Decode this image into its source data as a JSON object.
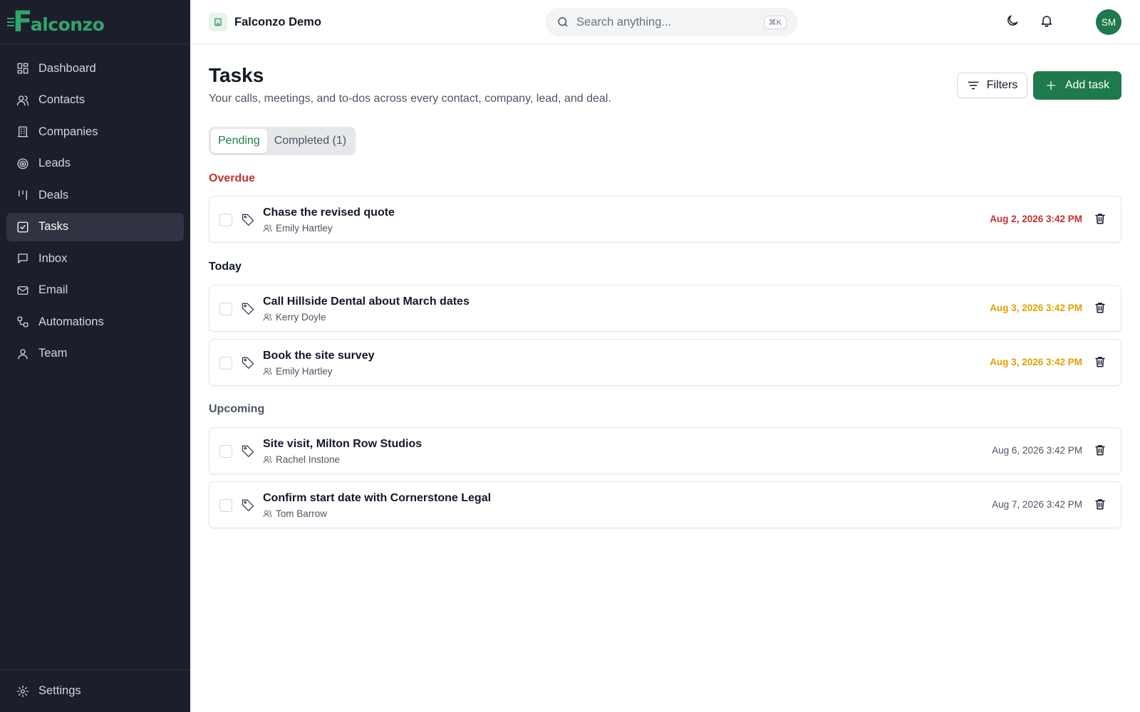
{
  "colors": {
    "sidebar_bg": "#1c1f2b",
    "brand": "#1e7a4c",
    "overdue": "#c53030",
    "today": "#e0a100",
    "upcoming": "#4b5563"
  },
  "brand": {
    "name": "alconzo",
    "mark": "F"
  },
  "sidebar": {
    "items": [
      {
        "label": "Dashboard",
        "icon": "dashboard-icon"
      },
      {
        "label": "Contacts",
        "icon": "users-icon"
      },
      {
        "label": "Companies",
        "icon": "building-icon"
      },
      {
        "label": "Leads",
        "icon": "target-icon"
      },
      {
        "label": "Deals",
        "icon": "kanban-icon"
      },
      {
        "label": "Tasks",
        "icon": "checkbox-icon",
        "active": true
      },
      {
        "label": "Inbox",
        "icon": "message-icon"
      },
      {
        "label": "Email",
        "icon": "mail-icon"
      },
      {
        "label": "Automations",
        "icon": "workflow-icon"
      },
      {
        "label": "Team",
        "icon": "user-icon"
      }
    ],
    "settings_label": "Settings"
  },
  "topbar": {
    "workspace": "Falconzo Demo",
    "search_placeholder": "Search anything...",
    "search_shortcut": "⌘K",
    "avatar_initials": "SM"
  },
  "page": {
    "title": "Tasks",
    "subtitle": "Your calls, meetings, and to-dos across every contact, company, lead, and deal.",
    "filters_label": "Filters",
    "add_label": "Add task",
    "tabs": [
      {
        "label": "Pending",
        "active": true
      },
      {
        "label": "Completed (1)",
        "active": false
      }
    ]
  },
  "sections": [
    {
      "heading": "Overdue",
      "tasks": [
        {
          "title": "Chase the revised quote",
          "person": "Emily Hartley",
          "due": "Aug 2, 2026 3:42 PM"
        }
      ]
    },
    {
      "heading": "Today",
      "tasks": [
        {
          "title": "Call Hillside Dental about March dates",
          "person": "Kerry Doyle",
          "due": "Aug 3, 2026 3:42 PM"
        },
        {
          "title": "Book the site survey",
          "person": "Emily Hartley",
          "due": "Aug 3, 2026 3:42 PM"
        }
      ]
    },
    {
      "heading": "Upcoming",
      "tasks": [
        {
          "title": "Site visit, Milton Row Studios",
          "person": "Rachel Instone",
          "due": "Aug 6, 2026 3:42 PM"
        },
        {
          "title": "Confirm start date with Cornerstone Legal",
          "person": "Tom Barrow",
          "due": "Aug 7, 2026 3:42 PM"
        }
      ]
    }
  ]
}
